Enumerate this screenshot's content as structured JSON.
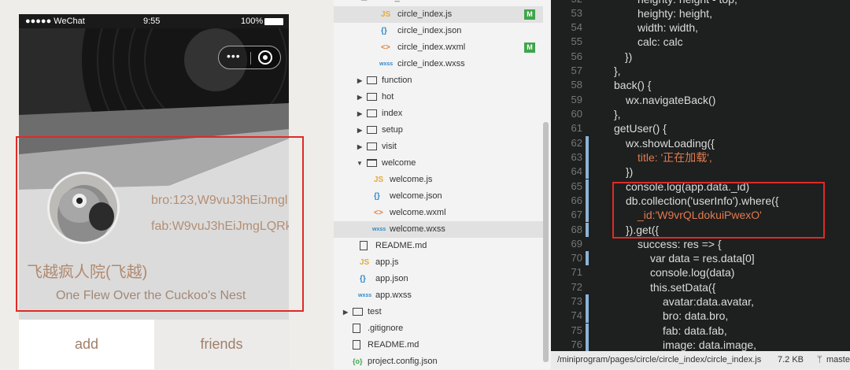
{
  "phone": {
    "status_bar": {
      "carrier": "●●●●● WeChat",
      "time": "9:55",
      "battery": "100%"
    },
    "profile": {
      "bro": "bro:123,W9vuJ3hEiJmgl",
      "fab": "fab:W9vuJ3hEiJmgLQRk",
      "name": "飞越疯人院(飞越)",
      "motto": "One Flew Over the Cuckoo's Nest"
    },
    "tabs": [
      {
        "label": "add"
      },
      {
        "label": "friends"
      }
    ]
  },
  "tree": {
    "items": [
      {
        "label": "circle_index.js",
        "kind": "js",
        "badge": "M"
      },
      {
        "label": "circle_index.json",
        "kind": "json"
      },
      {
        "label": "circle_index.wxml",
        "kind": "wxml",
        "badge": "M"
      },
      {
        "label": "circle_index.wxss",
        "kind": "wxss"
      },
      {
        "label": "function",
        "kind": "folder"
      },
      {
        "label": "hot",
        "kind": "folder"
      },
      {
        "label": "index",
        "kind": "folder"
      },
      {
        "label": "setup",
        "kind": "folder"
      },
      {
        "label": "visit",
        "kind": "folder"
      },
      {
        "label": "welcome",
        "kind": "folder-open"
      },
      {
        "label": "welcome.js",
        "kind": "js"
      },
      {
        "label": "welcome.json",
        "kind": "json"
      },
      {
        "label": "welcome.wxml",
        "kind": "wxml"
      },
      {
        "label": "welcome.wxss",
        "kind": "wxss"
      },
      {
        "label": "README.md",
        "kind": "file"
      },
      {
        "label": "app.js",
        "kind": "js"
      },
      {
        "label": "app.json",
        "kind": "json"
      },
      {
        "label": "app.wxss",
        "kind": "wxss"
      },
      {
        "label": "test",
        "kind": "folder"
      },
      {
        "label": ".gitignore",
        "kind": "file"
      },
      {
        "label": "README.md",
        "kind": "file"
      },
      {
        "label": "project.config.json",
        "kind": "json"
      }
    ]
  },
  "editor": {
    "lines": [
      {
        "n": "53",
        "text": "heighty: height,"
      },
      {
        "n": "54",
        "text": "width: width,"
      },
      {
        "n": "55",
        "text": "calc: calc"
      },
      {
        "n": "56",
        "text": "})"
      },
      {
        "n": "57",
        "text": "},"
      },
      {
        "n": "58",
        "text": "back() {"
      },
      {
        "n": "59",
        "text": "wx.navigateBack()"
      },
      {
        "n": "60",
        "text": "},"
      },
      {
        "n": "61",
        "text": "getUser() {"
      },
      {
        "n": "62",
        "text": "wx.showLoading({"
      },
      {
        "n": "63",
        "text": "title: '正在加载',"
      },
      {
        "n": "64",
        "text": "})"
      },
      {
        "n": "65",
        "text": "console.log(app.data._id)"
      },
      {
        "n": "66",
        "text": "db.collection('userInfo').where({"
      },
      {
        "n": "67",
        "text": "_id:'W9vrQLdokuiPwexO'"
      },
      {
        "n": "68",
        "text": "}).get({"
      },
      {
        "n": "69",
        "text": "success: res => {"
      },
      {
        "n": "70",
        "text": "var data = res.data[0]"
      },
      {
        "n": "71",
        "text": "console.log(data)"
      },
      {
        "n": "72",
        "text": "this.setData({"
      },
      {
        "n": "73",
        "text": "avatar:data.avatar,"
      },
      {
        "n": "74",
        "text": "bro: data.bro,"
      },
      {
        "n": "75",
        "text": "fab: data.fab,"
      },
      {
        "n": "76",
        "text": "image: data.image,"
      }
    ],
    "status": {
      "path": "/miniprogram/pages/circle/circle_index/circle_index.js",
      "size": "7.2 KB",
      "branch": "maste"
    }
  },
  "colors": {
    "highlight": "#e02a26",
    "modified": "#3fa54b",
    "accent_text": "#b08a70"
  }
}
